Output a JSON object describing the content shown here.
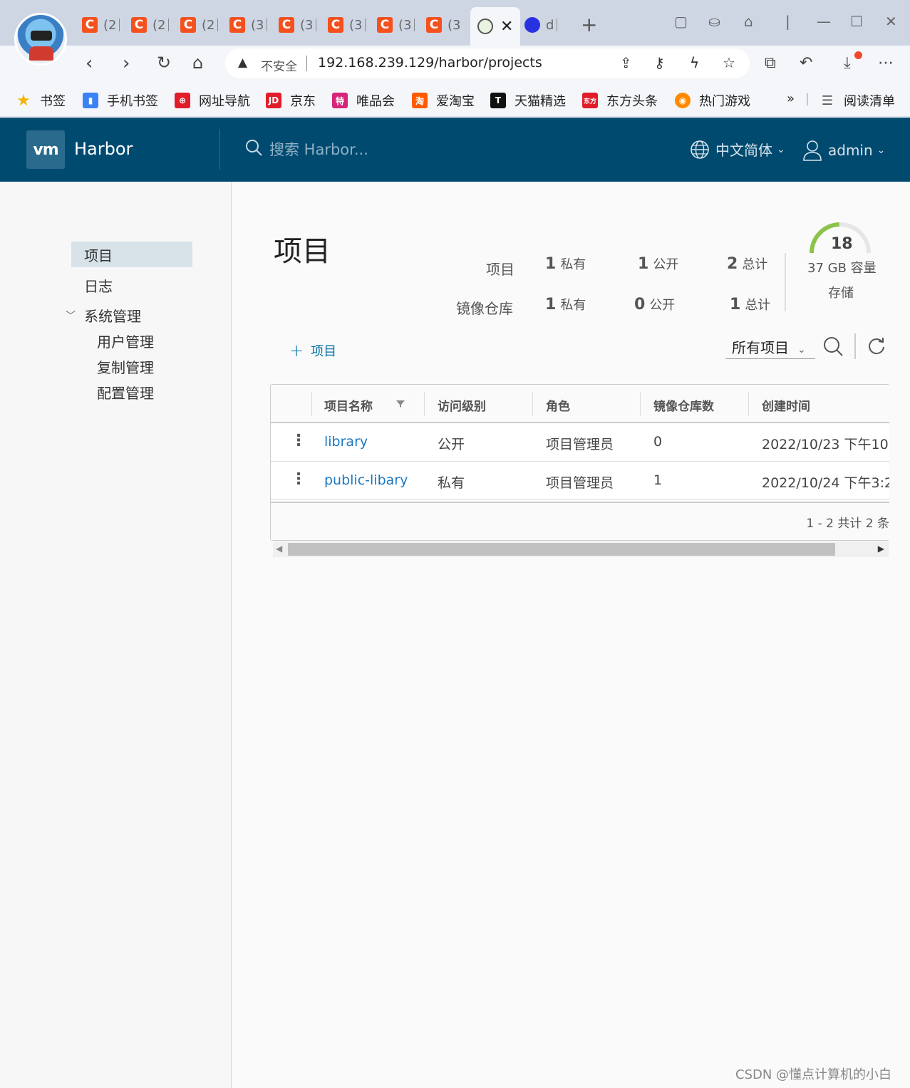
{
  "browser": {
    "tabs": [
      {
        "label": "(2"
      },
      {
        "label": "(2"
      },
      {
        "label": "(2"
      },
      {
        "label": "(3"
      },
      {
        "label": "(3"
      },
      {
        "label": "(3"
      },
      {
        "label": "(3"
      },
      {
        "label": "(3"
      }
    ],
    "active_tab_close": "✕",
    "last_tab_label": "d",
    "address": {
      "security_label": "不安全",
      "url": "192.168.239.129/harbor/projects"
    },
    "bookmarks": [
      {
        "label": "书签",
        "color": "#f5b400"
      },
      {
        "label": "手机书签",
        "color": "#3b82f6"
      },
      {
        "label": "网址导航",
        "color": "#e11d2a"
      },
      {
        "label": "京东",
        "color": "#e11d2a",
        "icon_text": "JD"
      },
      {
        "label": "唯品会",
        "color": "#d6247a",
        "icon_text": "特"
      },
      {
        "label": "爱淘宝",
        "color": "#ff5a00",
        "icon_text": "淘"
      },
      {
        "label": "天猫精选",
        "color": "#111111",
        "icon_text": "T"
      },
      {
        "label": "东方头条",
        "color": "#e11d2a",
        "icon_text": "东方"
      },
      {
        "label": "热门游戏",
        "color": "#ff8a00"
      }
    ],
    "bookmarks_more": "»",
    "reading_list": "阅读清单"
  },
  "harbor": {
    "logo_text": "vm",
    "brand": "Harbor",
    "search_placeholder": "搜索 Harbor...",
    "language": "中文简体",
    "user": "admin"
  },
  "sidebar": {
    "items": [
      {
        "label": "项目"
      },
      {
        "label": "日志"
      },
      {
        "label": "系统管理"
      },
      {
        "label": "用户管理"
      },
      {
        "label": "复制管理"
      },
      {
        "label": "配置管理"
      }
    ]
  },
  "summary": {
    "title": "项目",
    "rows": [
      {
        "label": "项目",
        "private_num": "1",
        "private_unit": "私有",
        "public_num": "1",
        "public_unit": "公开",
        "total_num": "2",
        "total_unit": "总计"
      },
      {
        "label": "镜像仓库",
        "private_num": "1",
        "private_unit": "私有",
        "public_num": "0",
        "public_unit": "公开",
        "total_num": "1",
        "total_unit": "总计"
      }
    ],
    "storage": {
      "value": "18",
      "capacity": "37 GB 容量",
      "label": "存储",
      "used_fraction": 0.49,
      "color": "#8cc34a"
    }
  },
  "toolbar": {
    "add_label": "项目",
    "filter_label": "所有项目"
  },
  "grid": {
    "columns": [
      "项目名称",
      "访问级别",
      "角色",
      "镜像仓库数",
      "创建时间"
    ],
    "rows": [
      {
        "name": "library",
        "access": "公开",
        "role": "项目管理员",
        "repo_count": "0",
        "created": "2022/10/23 下午10:"
      },
      {
        "name": "public-libary",
        "access": "私有",
        "role": "项目管理员",
        "repo_count": "1",
        "created": "2022/10/24 下午3:2"
      }
    ],
    "pagination": "1 - 2 共计 2 条"
  },
  "watermark": "CSDN @懂点计算机的小白"
}
